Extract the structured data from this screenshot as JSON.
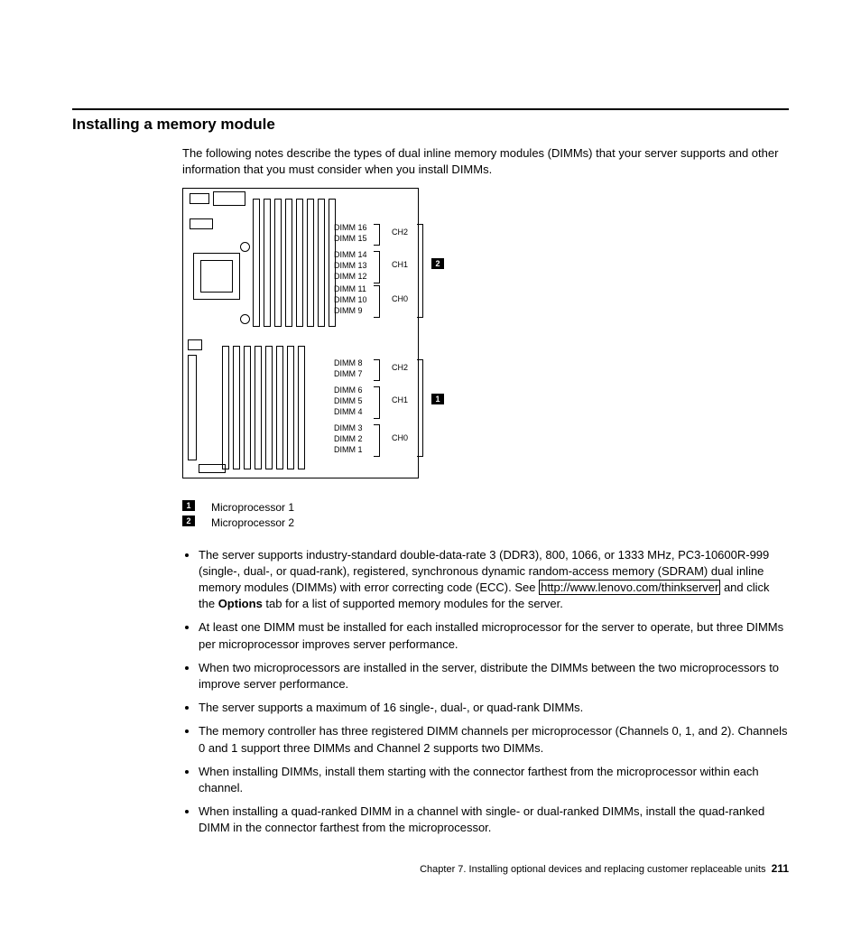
{
  "heading": "Installing a memory module",
  "intro": "The following notes describe the types of dual inline memory modules (DIMMs) that your server supports and other information that you must consider when you install DIMMs.",
  "diagram": {
    "top": {
      "dimms": [
        "DIMM 16",
        "DIMM 15",
        "DIMM 14",
        "DIMM 13",
        "DIMM 12",
        "DIMM 11",
        "DIMM 10",
        "DIMM 9"
      ],
      "channels": [
        "CH2",
        "CH1",
        "CH0"
      ],
      "index": "2"
    },
    "bottom": {
      "dimms": [
        "DIMM 8",
        "DIMM 7",
        "DIMM 6",
        "DIMM 5",
        "DIMM 4",
        "DIMM 3",
        "DIMM 2",
        "DIMM 1"
      ],
      "channels": [
        "CH2",
        "CH1",
        "CH0"
      ],
      "index": "1"
    }
  },
  "legend": {
    "items": [
      {
        "idx": "1",
        "text": "Microprocessor 1"
      },
      {
        "idx": "2",
        "text": "Microprocessor 2"
      }
    ]
  },
  "bullets": {
    "b1a": "The server supports industry-standard double-data-rate 3 (DDR3), 800, 1066, or 1333 MHz, PC3-10600R-999 (single-, dual-, or quad-rank), registered, synchronous dynamic random-access memory (SDRAM) dual inline memory modules (DIMMs) with error correcting code (ECC). See ",
    "b1link": "http://www.lenovo.com/thinkserver",
    "b1b": " and click the ",
    "b1bold": "Options",
    "b1c": " tab for a list of supported memory modules for the server.",
    "b2": "At least one DIMM must be installed for each installed microprocessor for the server to operate, but three DIMMs per microprocessor improves server performance.",
    "b3": "When two microprocessors are installed in the server, distribute the DIMMs between the two microprocessors to improve server performance.",
    "b4": "The server supports a maximum of 16 single-, dual-, or quad-rank DIMMs.",
    "b5": "The memory controller has three registered DIMM channels per microprocessor (Channels 0, 1, and 2). Channels 0 and 1 support three DIMMs and Channel 2 supports two DIMMs.",
    "b6": "When installing DIMMs, install them starting with the connector farthest from the microprocessor within each channel.",
    "b7": "When installing a quad-ranked DIMM in a channel with single- or dual-ranked DIMMs, install the quad-ranked DIMM in the connector farthest from the microprocessor."
  },
  "footer": {
    "chapter": "Chapter 7. Installing optional devices and replacing customer replaceable units",
    "page": "211"
  }
}
